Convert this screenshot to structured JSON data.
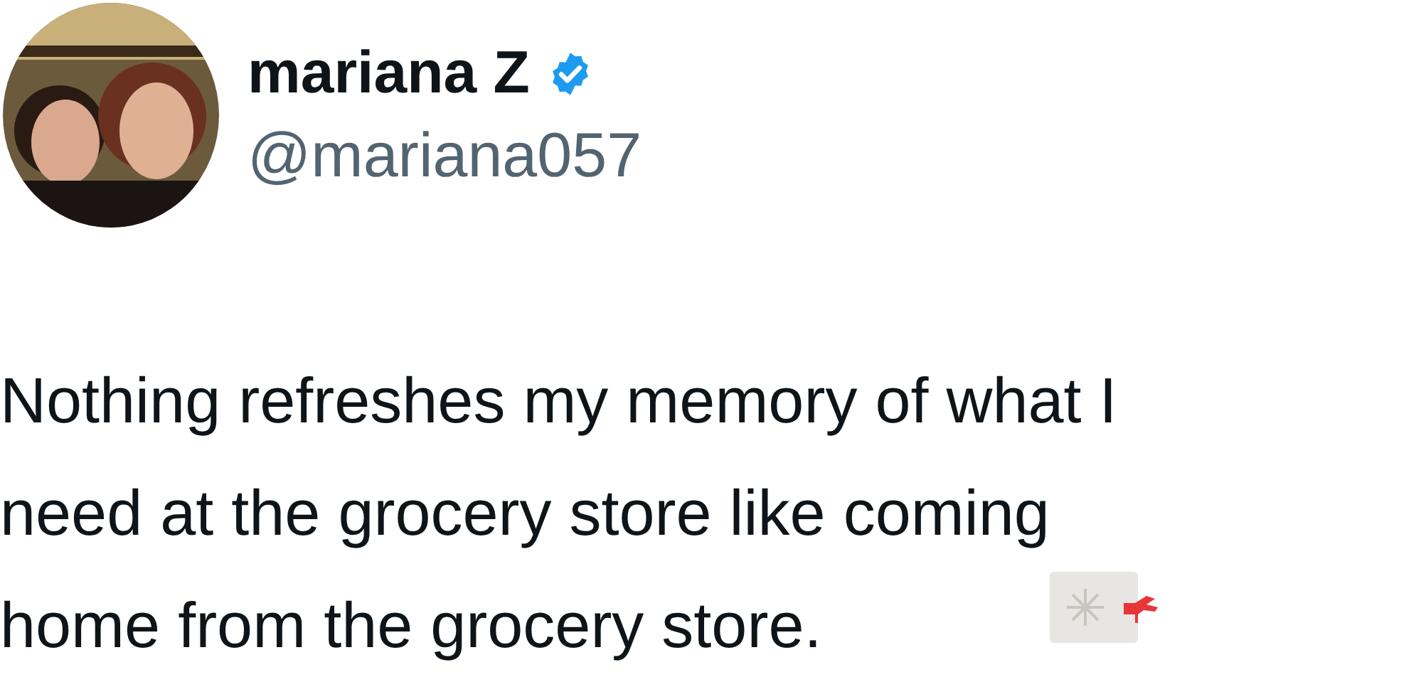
{
  "author": {
    "name": "mariana Z",
    "verified": true,
    "handle": "@mariana057"
  },
  "tweet": {
    "lines": [
      "Nothing refreshes my memory of what I",
      "need at the grocery store like coming",
      "home from the grocery store."
    ],
    "sticker": true
  }
}
